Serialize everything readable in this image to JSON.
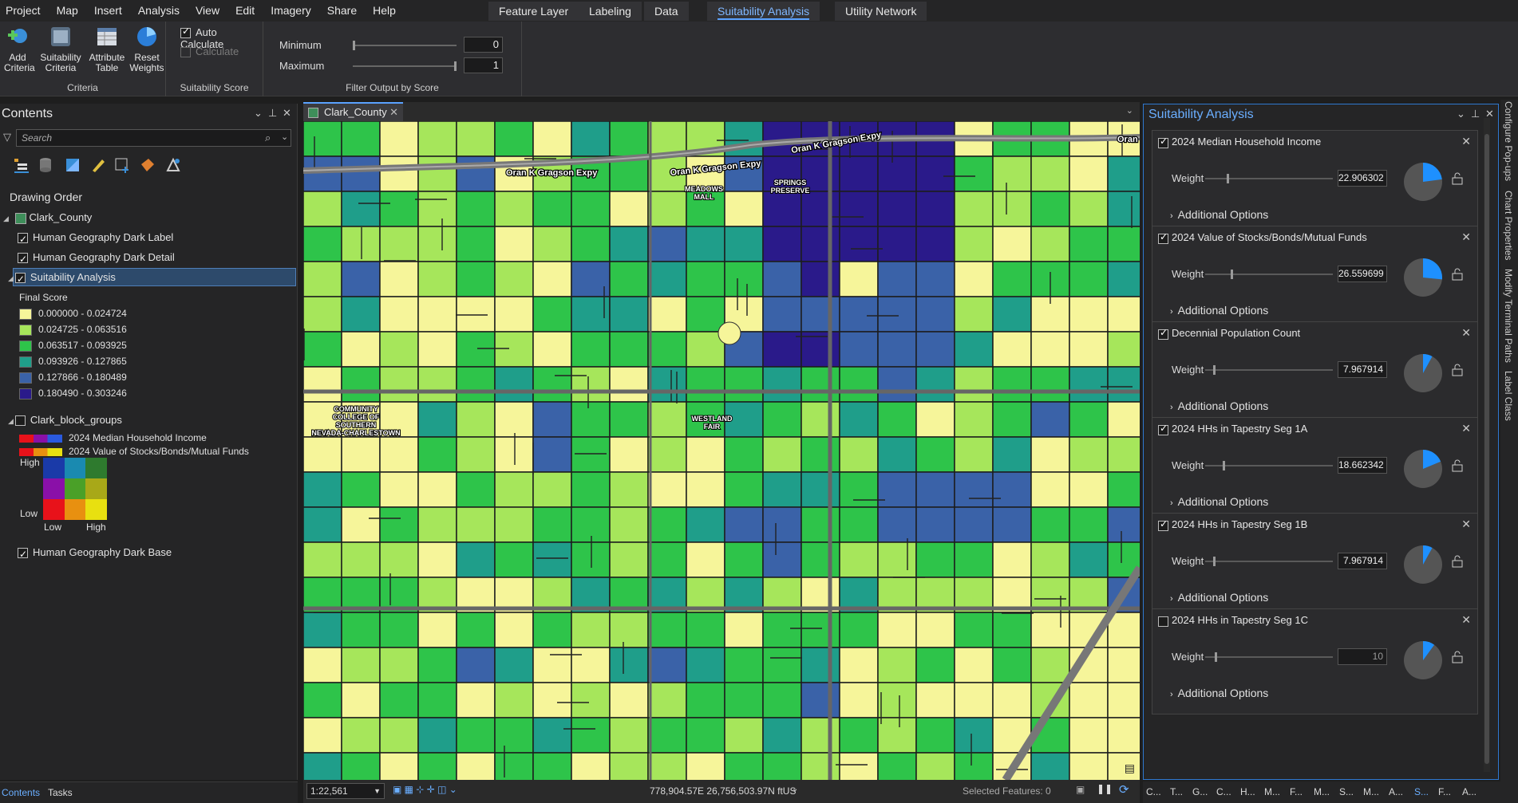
{
  "menubar": {
    "items": [
      "Project",
      "Map",
      "Insert",
      "Analysis",
      "View",
      "Edit",
      "Imagery",
      "Share",
      "Help"
    ],
    "context_tabs": [
      "Feature Layer",
      "Labeling",
      "Data"
    ],
    "active_tab": "Suitability Analysis",
    "extra_tab": "Utility Network"
  },
  "ribbon": {
    "criteria": {
      "label": "Criteria",
      "add_criteria": "Add Criteria",
      "suitability_criteria": "Suitability Criteria",
      "attribute_table": "Attribute Table",
      "reset_weights": "Reset Weights"
    },
    "score": {
      "label": "Suitability Score",
      "auto_calculate": "Auto Calculate",
      "calculate": "Calculate"
    },
    "filter": {
      "label": "Filter Output by Score",
      "minimum_label": "Minimum",
      "minimum_value": "0",
      "maximum_label": "Maximum",
      "maximum_value": "1"
    }
  },
  "contents": {
    "title": "Contents",
    "search_placeholder": "Search",
    "drawing_order": "Drawing Order",
    "map_name": "Clark_County",
    "layers": {
      "label_layer": "Human Geography Dark Label",
      "detail_layer": "Human Geography Dark Detail",
      "suitability": "Suitability Analysis",
      "final_score": "Final Score",
      "block_groups": "Clark_block_groups",
      "base_layer": "Human Geography Dark Base"
    },
    "legend": [
      {
        "label": "0.000000 - 0.024724",
        "color": "#f6f59a"
      },
      {
        "label": "0.024725 - 0.063516",
        "color": "#a6e65b"
      },
      {
        "label": "0.063517 - 0.093925",
        "color": "#2ec44a"
      },
      {
        "label": "0.093926 - 0.127865",
        "color": "#1f9e8a"
      },
      {
        "label": "0.127866 - 0.180489",
        "color": "#3a62a8"
      },
      {
        "label": "0.180490 - 0.303246",
        "color": "#2a1a8a"
      }
    ],
    "bivariate": {
      "var1": "2024 Median Household Income",
      "var2": "2024 Value of Stocks/Bonds/Mutual Funds",
      "high": "High",
      "low": "Low",
      "low_x": "Low",
      "high_x": "High"
    },
    "bottom_tabs": [
      "Contents",
      "Tasks"
    ]
  },
  "map": {
    "tab": "Clark_County",
    "scale": "1:22,561",
    "coordinates": "778,904.57E 26,756,503.97N ftUS",
    "selected_features": "Selected Features: 0",
    "labels": {
      "road1": "Oran K Gragson Expy",
      "road2": "Oran K Gragson Expy",
      "road3": "Oran K Gragson Expy",
      "road4": "Oran",
      "mall": "MEADOWS\nMALL",
      "preserve": "SPRINGS\nPRESERVE",
      "college": "COMMUNITY\nCOLLEGE OF\nSOUTHERN\nNEVADA-CHARLESTOWN",
      "fair": "WESTLAND\nFAIR"
    }
  },
  "suitability": {
    "title": "Suitability Analysis",
    "criteria": [
      {
        "name": "2024 Median Household Income",
        "checked": true,
        "weight": "22.906302",
        "pct": 0.229,
        "options": "Additional Options"
      },
      {
        "name": "2024 Value of Stocks/Bonds/Mutual Funds",
        "checked": true,
        "weight": "26.559699",
        "pct": 0.266,
        "options": "Additional Options"
      },
      {
        "name": "Decennial Population Count",
        "checked": true,
        "weight": "7.967914",
        "pct": 0.08,
        "options": "Additional Options"
      },
      {
        "name": "2024 HHs in Tapestry Seg 1A",
        "checked": true,
        "weight": "18.662342",
        "pct": 0.187,
        "options": "Additional Options"
      },
      {
        "name": "2024 HHs in Tapestry Seg 1B",
        "checked": true,
        "weight": "7.967914",
        "pct": 0.08,
        "options": "Additional Options"
      },
      {
        "name": "2024 HHs in Tapestry Seg 1C",
        "checked": false,
        "weight": "10",
        "pct": 0.1,
        "options": "Additional Options"
      }
    ],
    "weight_label": "Weight",
    "accent": "#1e90ff"
  },
  "right_strip": [
    "Configure Pop-ups",
    "Chart Properties",
    "Modify Terminal Paths",
    "Label Class"
  ],
  "bottom_right_tabs": [
    "C...",
    "T...",
    "G...",
    "C...",
    "H...",
    "M...",
    "F...",
    "M...",
    "S...",
    "M...",
    "A...",
    "S...",
    "F...",
    "A..."
  ]
}
